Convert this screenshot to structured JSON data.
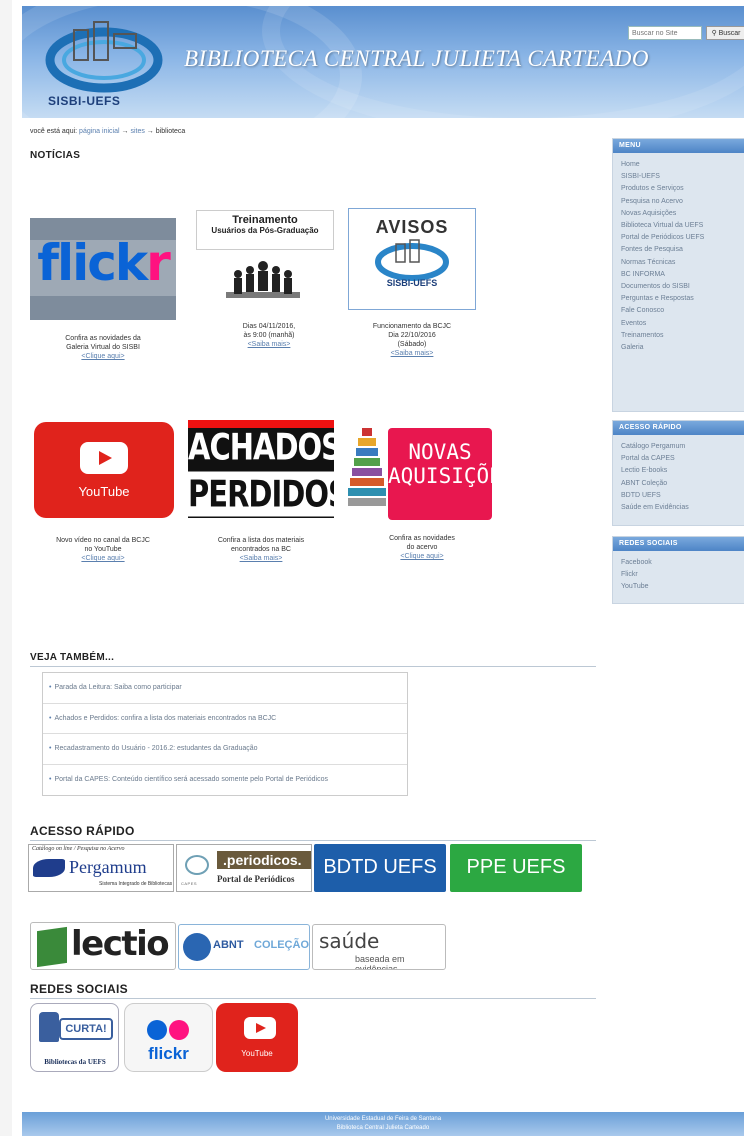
{
  "header": {
    "logo_text": "SISBI-UEFS",
    "site_title": "BIBLIOTECA CENTRAL JULIETA CARTEADO",
    "search_placeholder": "Buscar no Site",
    "search_button": "Buscar"
  },
  "breadcrumb": {
    "prefix": "você está aqui:",
    "items": [
      "página inicial",
      "sites",
      "biblioteca"
    ],
    "separator": "→"
  },
  "noticias": {
    "heading": "NOTÍCIAS",
    "tiles": [
      {
        "image_text": "flickr",
        "lines": [
          "Confira as novidades da",
          "Galeria Virtual do SISBI"
        ],
        "link": "<Clique aqui>"
      },
      {
        "image_title": "Treinamento",
        "image_subtitle": "Usuários da Pós-Graduação",
        "lines": [
          "Dias 04/11/2016,",
          "às 9:00 (manhã)"
        ],
        "link": "<Saiba mais>"
      },
      {
        "image_title": "AVISOS",
        "image_logo": "SISBI-UEFS",
        "lines": [
          "Funcionamento da BCJC",
          "Dia 22/10/2016",
          "(Sábado)"
        ],
        "link": "<Saiba mais>"
      },
      {
        "image_text": "YouTube",
        "lines": [
          "Novo vídeo no canal da BCJC",
          "no YouTube"
        ],
        "link": "<Clique aqui>"
      },
      {
        "image_line1": "ACHADOS E",
        "image_line2": "PERDIDOS",
        "lines": [
          "Confira a lista dos materiais",
          "encontrados na BC"
        ],
        "link": "<Saiba mais>"
      },
      {
        "image_line1": "NOVAS",
        "image_line2": "AQUISIÇÕES",
        "lines": [
          "Confira as novidades",
          "do acervo"
        ],
        "link": "<Clique aqui>"
      }
    ]
  },
  "veja": {
    "heading": "VEJA TAMBÉM...",
    "items": [
      "Parada da Leitura: Saiba como participar",
      "Achados e Perdidos: confira a lista dos materiais encontrados na BCJC",
      "Recadastramento do Usuário - 2016.2: estudantes da Graduação",
      "Portal da CAPES: Conteúdo científico será acessado somente pelo Portal de Periódicos"
    ]
  },
  "acesso": {
    "heading": "ACESSO RÁPIDO",
    "pergamum": {
      "top": "Catálogo on line / Pesquisa no Acervo",
      "name": "Pergamum",
      "sub": "Sistema Integrado de Bibliotecas"
    },
    "periodicos": {
      "top": ".periodicos.",
      "sub": "Portal de Periódicos",
      "org": "CAPES"
    },
    "bdtd": "BDTD UEFS",
    "ppe": "PPE UEFS",
    "lectio": "lectio",
    "abnt": {
      "a": "ABNT",
      "b": "COLEÇÃO"
    },
    "saude": {
      "a": "saúde",
      "b": "baseada em evidências"
    }
  },
  "redes": {
    "heading": "REDES SOCIAIS",
    "curtir": {
      "a": "CURTA!",
      "b": "Bibliotecas da UEFS"
    },
    "flickr": "flickr",
    "youtube": "YouTube"
  },
  "sidebar": {
    "menu": {
      "title": "MENU",
      "items": [
        "Home",
        "SISBI-UEFS",
        "Produtos e Serviços",
        "Pesquisa no Acervo",
        "Novas Aquisições",
        "Biblioteca Virtual da UEFS",
        "Portal de Periódicos UEFS",
        "Fontes de Pesquisa",
        "Normas Técnicas",
        "BC INFORMA",
        "Documentos do SISBI",
        "Perguntas e Respostas",
        "Fale Conosco",
        "Eventos",
        "Treinamentos",
        "Galeria"
      ]
    },
    "acesso": {
      "title": "ACESSO RÁPIDO",
      "items": [
        "Catálogo Pergamum",
        "Portal da CAPES",
        "Lectio E-books",
        "ABNT Coleção",
        "BDTD UEFS",
        "Saúde em Evidências"
      ]
    },
    "redes": {
      "title": "REDES SOCIAIS",
      "items": [
        "Facebook",
        "Flickr",
        "YouTube"
      ]
    }
  },
  "footer": {
    "line1": "Universidade Estadual de Feira de Santana",
    "line2": "Biblioteca Central Julieta Carteado"
  },
  "colors": {
    "header_blue": "#5a8fcf",
    "link_blue": "#5a7fae",
    "youtube_red": "#e0231c",
    "novas_pink": "#e8174f",
    "bdtd_blue": "#1d5eaa",
    "ppe_green": "#2ca842"
  }
}
